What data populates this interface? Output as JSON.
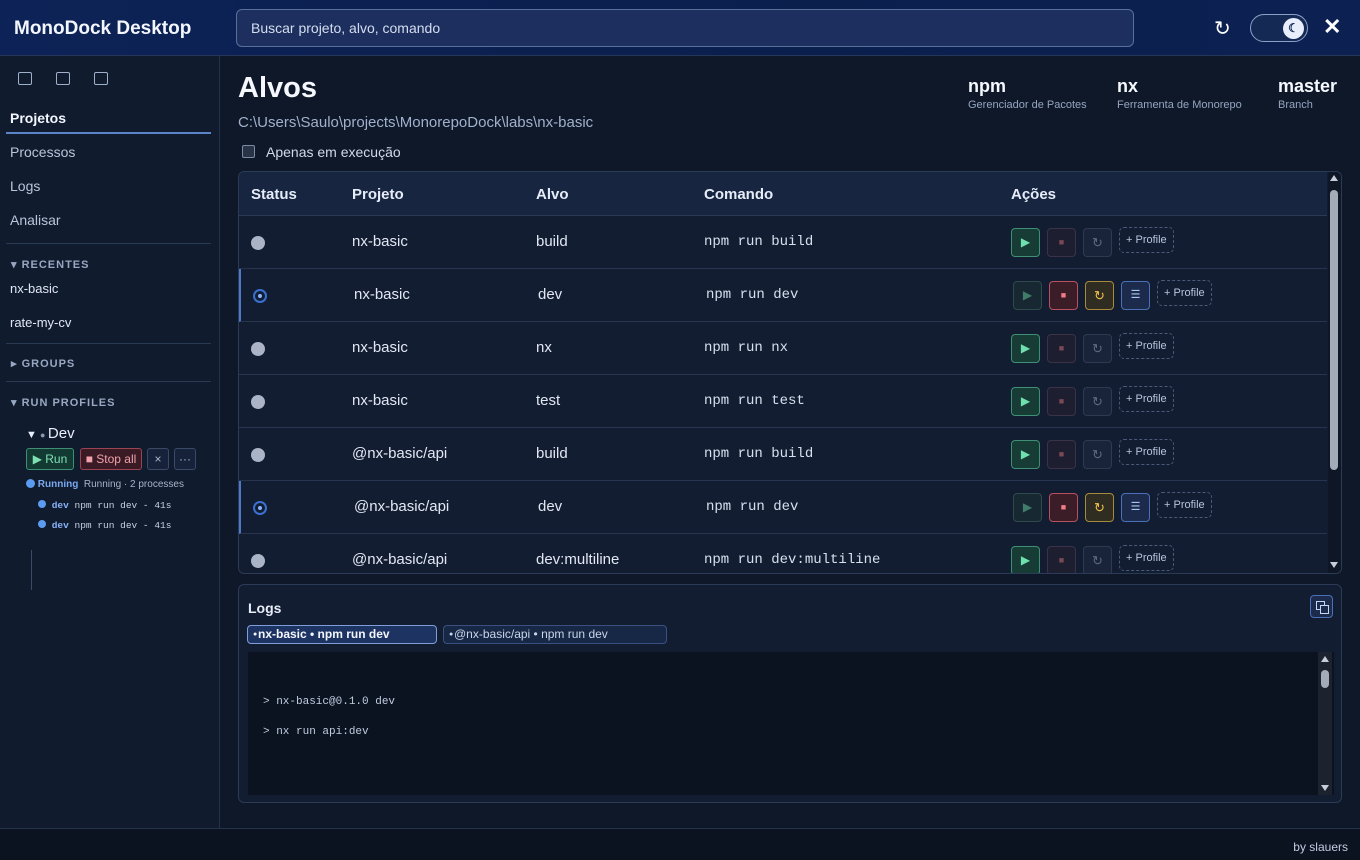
{
  "app": {
    "title": "MonoDock Desktop"
  },
  "search": {
    "placeholder": "Buscar projeto, alvo, comando"
  },
  "top": {
    "refresh_icon": "↻",
    "theme_icon": "☾",
    "close_icon": "✕"
  },
  "sidebar": {
    "nav": [
      {
        "label": "Projetos"
      },
      {
        "label": "Processos"
      },
      {
        "label": "Logs"
      },
      {
        "label": "Analisar"
      }
    ],
    "recent_header": "RECENTES",
    "recent": [
      "nx-basic",
      "rate-my-cv"
    ],
    "groups_header": "GROUPS",
    "run_profiles_header": "RUN PROFILES",
    "profile": {
      "name": "Dev",
      "run_label": "▶ Run",
      "stop_label": "■ Stop all",
      "remove_label": "×",
      "more_label": "···",
      "status": "Running",
      "status_detail": "Running · 2 processes",
      "processes": [
        {
          "name": "dev",
          "cmd": "npm run dev - 41s"
        },
        {
          "name": "dev",
          "cmd": "npm run dev - 41s"
        }
      ]
    }
  },
  "main": {
    "title": "Alvos",
    "path": "C:\\Users\\Saulo\\projects\\MonorepoDock\\labs\\nx-basic",
    "meta": [
      {
        "value": "npm",
        "label": "Gerenciador de Pacotes"
      },
      {
        "value": "nx",
        "label": "Ferramenta de Monorepo"
      },
      {
        "value": "master",
        "label": "Branch"
      }
    ],
    "only_running_label": "Apenas em execução",
    "columns": [
      "Status",
      "Projeto",
      "Alvo",
      "Comando",
      "Ações"
    ],
    "rows": [
      {
        "project": "nx-basic",
        "target": "build",
        "command": "npm run build",
        "running": false
      },
      {
        "project": "nx-basic",
        "target": "dev",
        "command": "npm run dev",
        "running": true
      },
      {
        "project": "nx-basic",
        "target": "nx",
        "command": "npm run nx",
        "running": false
      },
      {
        "project": "nx-basic",
        "target": "test",
        "command": "npm run test",
        "running": false
      },
      {
        "project": "@nx-basic/api",
        "target": "build",
        "command": "npm run build",
        "running": false
      },
      {
        "project": "@nx-basic/api",
        "target": "dev",
        "command": "npm run dev",
        "running": true
      },
      {
        "project": "@nx-basic/api",
        "target": "dev:multiline",
        "command": "npm run dev:multiline",
        "running": false
      }
    ],
    "profile_label": "+ Profile"
  },
  "logs": {
    "title": "Logs",
    "tabs": [
      "nx-basic • npm run dev",
      "@nx-basic/api • npm run dev"
    ],
    "lines": [
      "> nx-basic@0.1.0 dev",
      "> nx run api:dev"
    ]
  },
  "footer": {
    "text": "by slauers"
  }
}
